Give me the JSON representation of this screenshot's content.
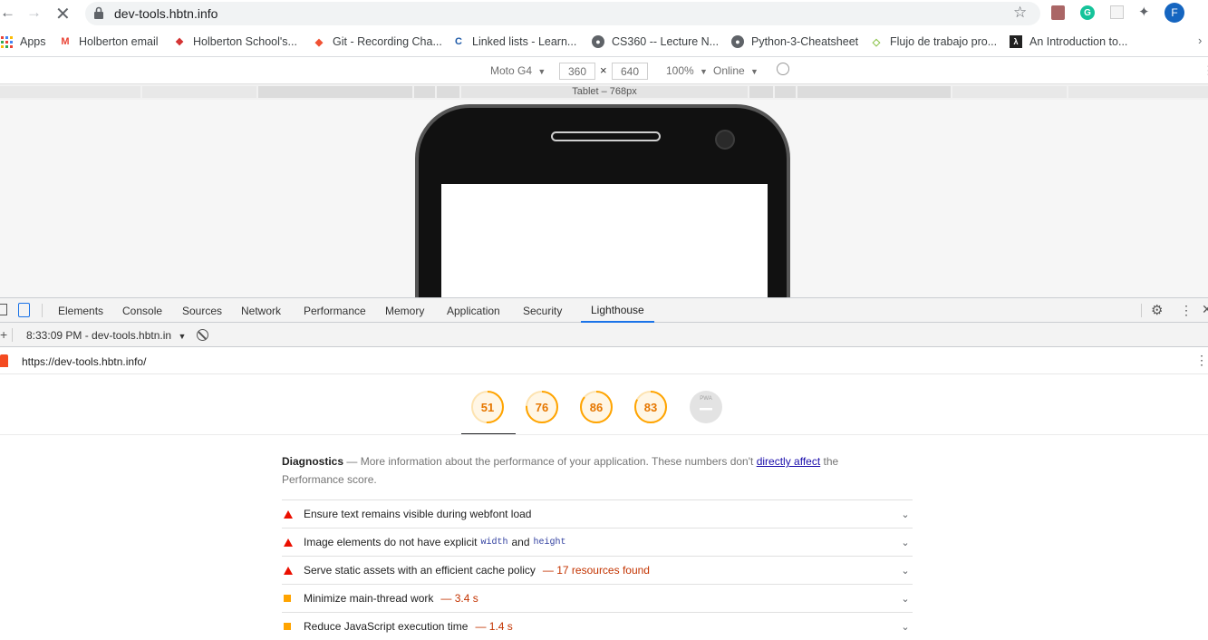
{
  "browser": {
    "url": "dev-tools.hbtn.info",
    "profile_initial": "F"
  },
  "bookmarks": [
    {
      "label": "Apps",
      "icon": "apps-grid-icon"
    },
    {
      "label": "Holberton email",
      "icon": "gmail-icon"
    },
    {
      "label": "Holberton School's...",
      "icon": "holberton-icon"
    },
    {
      "label": "Git - Recording Cha...",
      "icon": "git-icon"
    },
    {
      "label": "Linked lists - Learn...",
      "icon": "c-icon"
    },
    {
      "label": "CS360 -- Lecture N...",
      "icon": "globe-icon"
    },
    {
      "label": "Python-3-Cheatsheet",
      "icon": "globe-icon"
    },
    {
      "label": "Flujo de trabajo pro...",
      "icon": "diamond-icon"
    },
    {
      "label": "An Introduction to...",
      "icon": "lambda-icon"
    }
  ],
  "device_toolbar": {
    "device": "Moto G4",
    "width": "360",
    "height": "640",
    "zoom": "100%",
    "throttle": "Online",
    "media_label": "Tablet – 768px"
  },
  "devtools": {
    "tabs": [
      "Elements",
      "Console",
      "Sources",
      "Network",
      "Performance",
      "Memory",
      "Application",
      "Security",
      "Lighthouse"
    ],
    "active_tab": "Lighthouse",
    "report_label": "8:33:09 PM - dev-tools.hbtn.in",
    "report_url": "https://dev-tools.hbtn.info/"
  },
  "scores": [
    {
      "value": "51",
      "fraction": 0.51,
      "color": "#ffa400"
    },
    {
      "value": "76",
      "fraction": 0.76,
      "color": "#ffa400"
    },
    {
      "value": "86",
      "fraction": 0.86,
      "color": "#ffa400"
    },
    {
      "value": "83",
      "fraction": 0.83,
      "color": "#ffa400"
    },
    {
      "value": "PWA",
      "fraction": 0,
      "color": "#cccccc"
    }
  ],
  "diagnostics": {
    "title": "Diagnostics",
    "dash": "—",
    "text_before": "More information about the performance of your application. These numbers don't",
    "link": "directly affect",
    "text_after": "the Performance score."
  },
  "audits": [
    {
      "type": "fail",
      "text": "Ensure text remains visible during webfont load",
      "extra": ""
    },
    {
      "type": "fail",
      "text_a": "Image elements do not have explicit",
      "code1": "width",
      "and": "and",
      "code2": "height"
    },
    {
      "type": "fail",
      "text": "Serve static assets with an efficient cache policy",
      "extra": "— 17 resources found"
    },
    {
      "type": "average",
      "text": "Minimize main-thread work",
      "extra": "— 3.4 s"
    },
    {
      "type": "average",
      "text": "Reduce JavaScript execution time",
      "extra": "— 1.4 s"
    }
  ],
  "colors": {
    "fail": "#eb0f00",
    "average": "#ffa400",
    "accent": "#1a73e8"
  }
}
